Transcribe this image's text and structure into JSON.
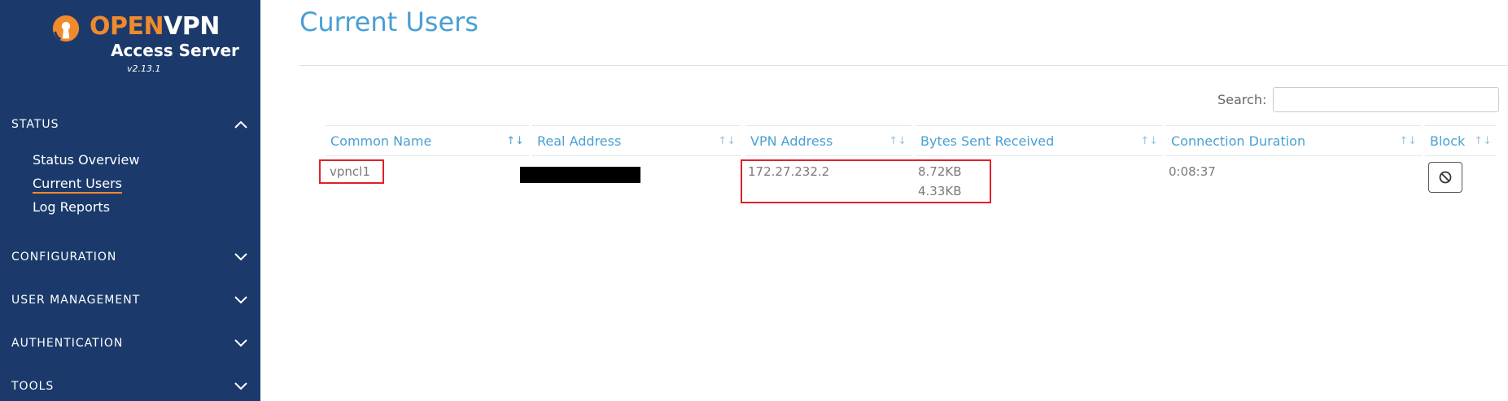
{
  "sidebar": {
    "logo": {
      "brand_open": "OPEN",
      "brand_vpn": "VPN",
      "product": "Access Server",
      "version": "v2.13.1"
    },
    "sections": [
      {
        "label": "STATUS",
        "expanded": true,
        "items": [
          {
            "label": "Status Overview",
            "active": false
          },
          {
            "label": "Current Users",
            "active": true
          },
          {
            "label": "Log Reports",
            "active": false
          }
        ]
      },
      {
        "label": "CONFIGURATION",
        "expanded": false
      },
      {
        "label": "USER  MANAGEMENT",
        "expanded": false
      },
      {
        "label": "AUTHENTICATION",
        "expanded": false
      },
      {
        "label": "TOOLS",
        "expanded": false
      }
    ]
  },
  "main": {
    "title": "Current Users",
    "search": {
      "label": "Search:",
      "value": "",
      "placeholder": ""
    },
    "table": {
      "columns": [
        "Common Name",
        "Real Address",
        "VPN Address",
        "Bytes Sent Received",
        "Connection Duration",
        "Block"
      ],
      "rows": [
        {
          "common_name": "vpncl1",
          "real_address": "[redacted]",
          "vpn_address": "172.27.232.2",
          "bytes_sent": "8.72KB",
          "bytes_received": "4.33KB",
          "duration": "0:08:37"
        }
      ]
    }
  },
  "colors": {
    "sidebar_bg": "#1b3a6b",
    "brand_orange": "#f08a2c",
    "accent_blue": "#4a9fd4",
    "highlight_red": "#e0202c"
  },
  "icons": {
    "section_chevron_open": "chevron-up-icon",
    "section_chevron_closed": "chevron-down-icon",
    "sort": "sort-arrows-icon",
    "block": "block-icon"
  }
}
